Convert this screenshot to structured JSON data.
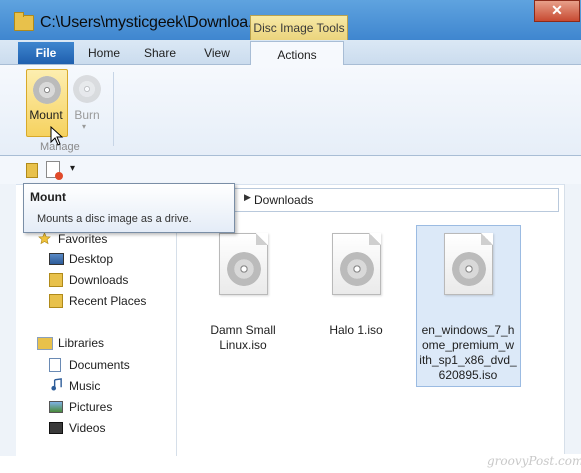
{
  "window": {
    "title": "C:\\Users\\mysticgeek\\Downloa...",
    "context_header": "Disc Image Tools",
    "close_glyph": "✕"
  },
  "ribbon": {
    "tabs": [
      "File",
      "Home",
      "Share",
      "View",
      "Actions"
    ],
    "mount_label": "Mount",
    "burn_label": "Burn",
    "group_label": "Manage"
  },
  "qat": {
    "dropdown_glyph": "▾"
  },
  "tooltip": {
    "title": "Mount",
    "description": "Mounts a disc image as a drive."
  },
  "address": {
    "arrow": "▶",
    "path": "Downloads"
  },
  "nav": {
    "favorites": "Favorites",
    "fav_items": [
      "Desktop",
      "Downloads",
      "Recent Places"
    ],
    "libraries": "Libraries",
    "lib_items": [
      "Documents",
      "Music",
      "Pictures",
      "Videos"
    ]
  },
  "files": [
    {
      "name_lines": [
        "Damn Small",
        "Linux.iso"
      ]
    },
    {
      "name_lines": [
        "Halo 1.iso"
      ]
    },
    {
      "name_lines": [
        "en_windows_7_h",
        "ome_premium_w",
        "ith_sp1_x86_dvd_",
        "620895.iso"
      ],
      "selected": true
    }
  ],
  "watermark": "groovyPost.com",
  "colors": {
    "title_bar": "#3f86cf",
    "context_tab": "#f6d25f",
    "selection": "#dce9f8"
  }
}
